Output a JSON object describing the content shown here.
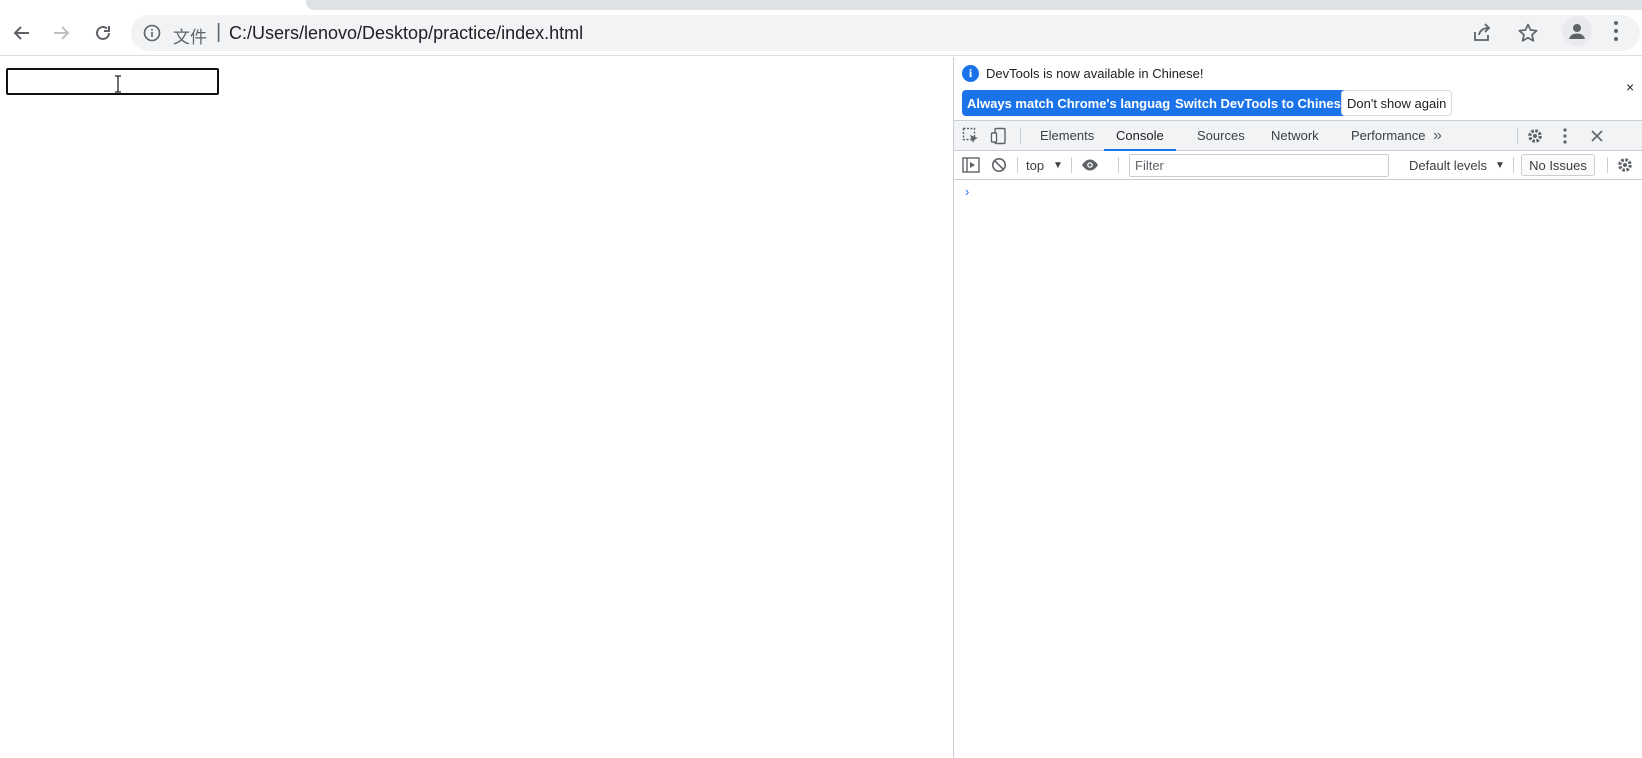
{
  "browser": {
    "omnibox": {
      "scheme_label": "文件",
      "separator": "|",
      "url": "C:/Users/lenovo/Desktop/practice/index.html"
    }
  },
  "devtools": {
    "infobar": {
      "message": "DevTools is now available in Chinese!",
      "buttons": {
        "always_match": "Always match Chrome's language",
        "switch": "Switch DevTools to Chinese",
        "dont_show": "Don't show again"
      },
      "close": "×"
    },
    "tabs": [
      "Elements",
      "Console",
      "Sources",
      "Network",
      "Performance"
    ],
    "active_tab": "Console",
    "more_tabs": "»",
    "console_toolbar": {
      "context": "top",
      "filter_placeholder": "Filter",
      "levels": "Default levels",
      "issues": "No Issues"
    },
    "prompt": "›"
  },
  "colors": {
    "accent": "#1a73e8",
    "toolbar_bg": "#f1f3f4",
    "border": "#cacdd1"
  }
}
